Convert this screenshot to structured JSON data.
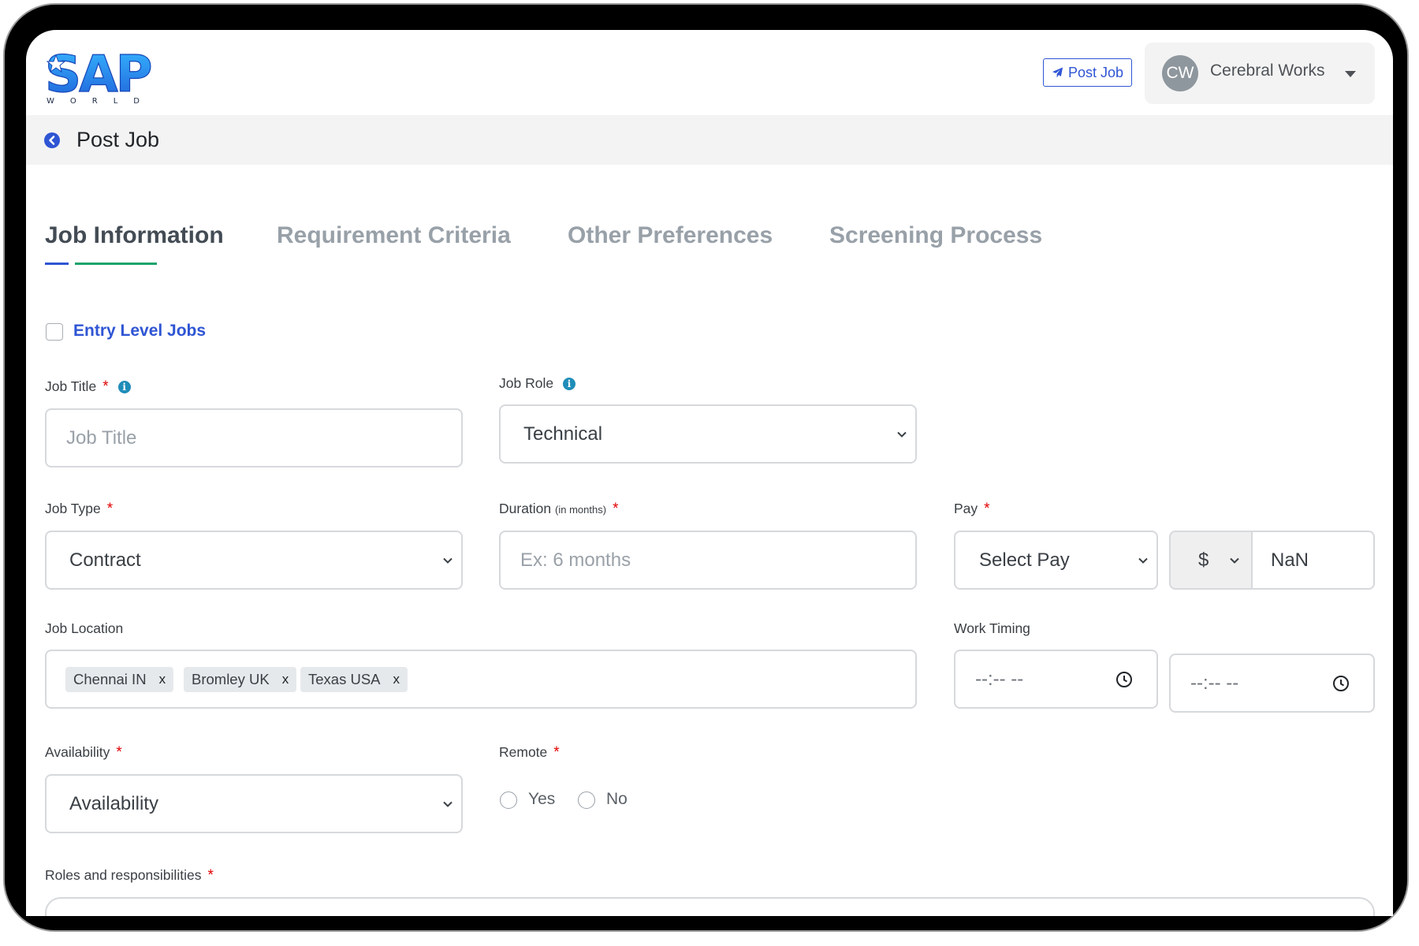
{
  "brand": {
    "logo_main": "SAP",
    "logo_sub": "WORLD",
    "colors": {
      "primary": "#2f55d4",
      "accent": "#19a36a",
      "required": "#e00000",
      "info": "#1f8db8"
    }
  },
  "header": {
    "post_job_label": "Post Job",
    "post_job_icon": "paper-plane-icon",
    "user_initials": "CW",
    "user_name": "Cerebral Works"
  },
  "page": {
    "title": "Post Job",
    "back_icon": "back-arrow-icon"
  },
  "tabs": [
    {
      "label": "Job Information",
      "active": true
    },
    {
      "label": "Requirement Criteria",
      "active": false
    },
    {
      "label": "Other Preferences",
      "active": false
    },
    {
      "label": "Screening Process",
      "active": false
    }
  ],
  "form": {
    "entry_level": {
      "label": "Entry Level Jobs",
      "checked": false
    },
    "job_title": {
      "label": "Job Title",
      "placeholder": "Job Title",
      "required": true
    },
    "job_role": {
      "label": "Job Role",
      "value": "Technical"
    },
    "job_type": {
      "label": "Job Type",
      "value": "Contract",
      "required": true
    },
    "duration": {
      "label": "Duration",
      "label_note": "(in months)",
      "placeholder": "Ex: 6 months",
      "required": true
    },
    "pay": {
      "label": "Pay",
      "select_value": "Select Pay",
      "currency": "$",
      "amount": "NaN",
      "required": true
    },
    "job_location": {
      "label": "Job Location",
      "tags": [
        "Chennai IN",
        "Bromley UK",
        "Texas USA"
      ],
      "remove_symbol": "x"
    },
    "work_timing": {
      "label": "Work Timing",
      "start": "--:-- --",
      "end": "--:-- --"
    },
    "availability": {
      "label": "Availability",
      "value": "Availability",
      "required": true
    },
    "remote": {
      "label": "Remote",
      "options": [
        "Yes",
        "No"
      ],
      "required": true
    },
    "roles": {
      "label": "Roles and responsibilities",
      "required": true
    }
  }
}
